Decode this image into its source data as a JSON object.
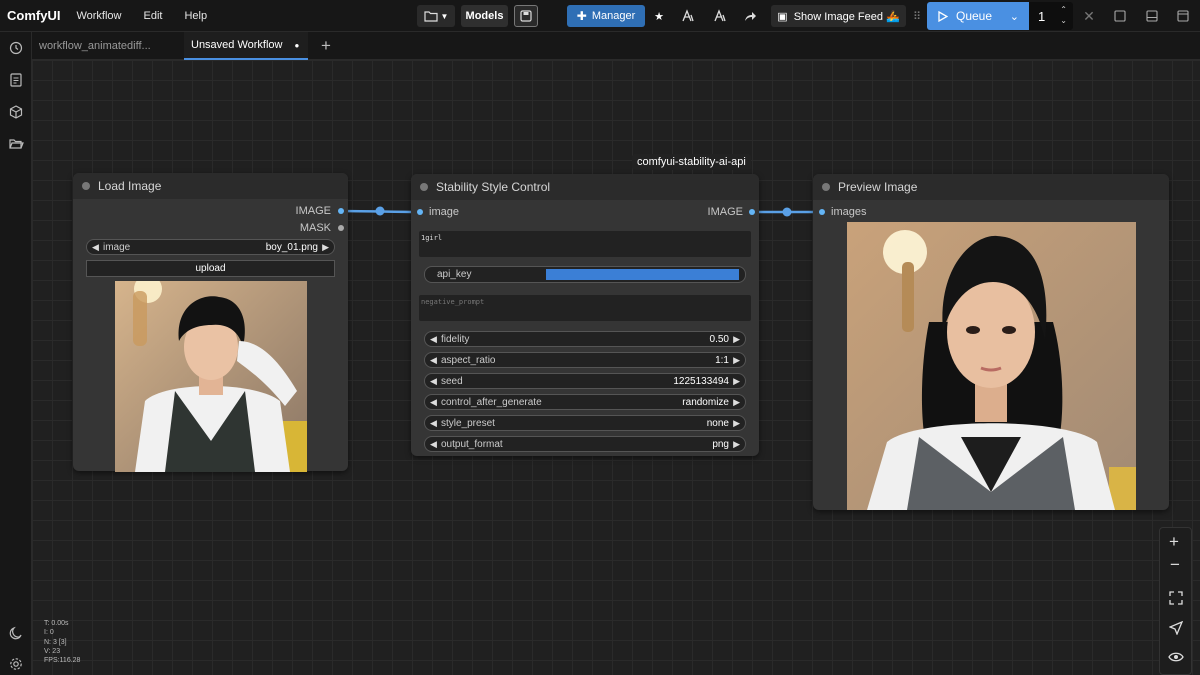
{
  "app": {
    "brand": "ComfyUI"
  },
  "menu": [
    "Workflow",
    "Edit",
    "Help"
  ],
  "toolbar": {
    "models_label": "Models",
    "manager_label": "Manager",
    "image_feed_label": "Show Image Feed 🚣",
    "queue_label": "Queue",
    "batch_count": "1",
    "accent": "#3b7fd6",
    "manager_color": "#2f6fb5"
  },
  "tabs": [
    {
      "label": "workflow_animatediff...",
      "active": false
    },
    {
      "label": "Unsaved Workflow",
      "active": true,
      "modified_marker": "●"
    }
  ],
  "nodes": {
    "load_image": {
      "title": "Load Image",
      "outputs": [
        "IMAGE",
        "MASK"
      ],
      "image_widget": {
        "label": "image",
        "value": "boy_01.png"
      },
      "upload_label": "upload"
    },
    "style_control": {
      "badge": "comfyui-stability-ai-api",
      "title": "Stability Style Control",
      "input": "image",
      "output": "IMAGE",
      "prompt": "1girl",
      "api_key_label": "api_key",
      "negative_prompt_placeholder": "negative_prompt",
      "widgets": [
        {
          "label": "fidelity",
          "value": "0.50"
        },
        {
          "label": "aspect_ratio",
          "value": "1:1"
        },
        {
          "label": "seed",
          "value": "1225133494"
        },
        {
          "label": "control_after_generate",
          "value": "randomize"
        },
        {
          "label": "style_preset",
          "value": "none"
        },
        {
          "label": "output_format",
          "value": "png"
        }
      ]
    },
    "preview_image": {
      "title": "Preview Image",
      "input": "images"
    }
  },
  "stats": [
    "T: 0.00s",
    "I: 0",
    "N: 3 [3]",
    "V: 23",
    "FPS:116.28"
  ],
  "colors": {
    "link": "#5aa0e6",
    "slot_image": "#64b5f6"
  }
}
